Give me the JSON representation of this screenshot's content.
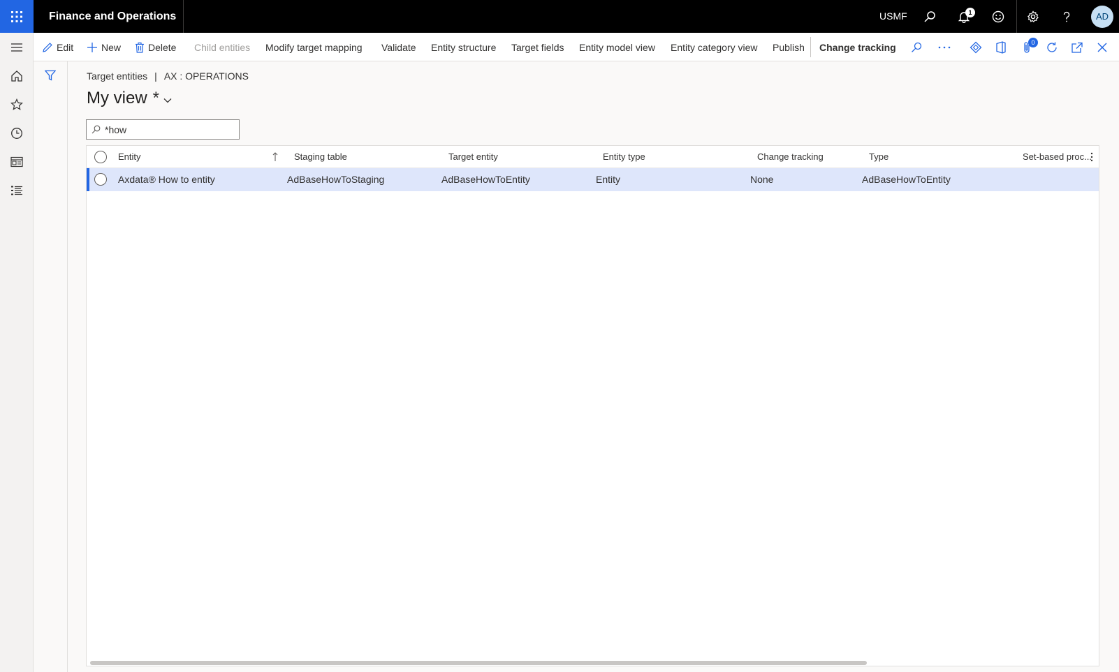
{
  "app": {
    "title": "Finance and Operations",
    "company": "USMF",
    "notification_count": "1",
    "user_initials": "AD"
  },
  "actions": {
    "edit": "Edit",
    "new": "New",
    "delete": "Delete",
    "child_entities": "Child entities",
    "modify_target_mapping": "Modify target mapping",
    "validate": "Validate",
    "entity_structure": "Entity structure",
    "target_fields": "Target fields",
    "entity_model_view": "Entity model view",
    "entity_category_view": "Entity category view",
    "publish": "Publish",
    "change_tracking": "Change tracking",
    "attachments_count": "0"
  },
  "page": {
    "breadcrumb_page": "Target entities",
    "breadcrumb_separator": "|",
    "breadcrumb_context": "AX : OPERATIONS",
    "view_name": "My view",
    "view_modified_marker": "*"
  },
  "search": {
    "value": "*how"
  },
  "grid": {
    "columns": [
      "Entity",
      "Staging table",
      "Target entity",
      "Entity type",
      "Change tracking",
      "Type",
      "Set-based proc..."
    ],
    "rows": [
      {
        "entity": "Axdata® How to entity",
        "staging_table": "AdBaseHowToStaging",
        "target_entity": "AdBaseHowToEntity",
        "entity_type": "Entity",
        "change_tracking": "None",
        "type": "AdBaseHowToEntity",
        "set_based": ""
      }
    ]
  },
  "colors": {
    "accent": "#2266e3",
    "selected_row": "#dee6fb",
    "topbar": "#000000"
  }
}
